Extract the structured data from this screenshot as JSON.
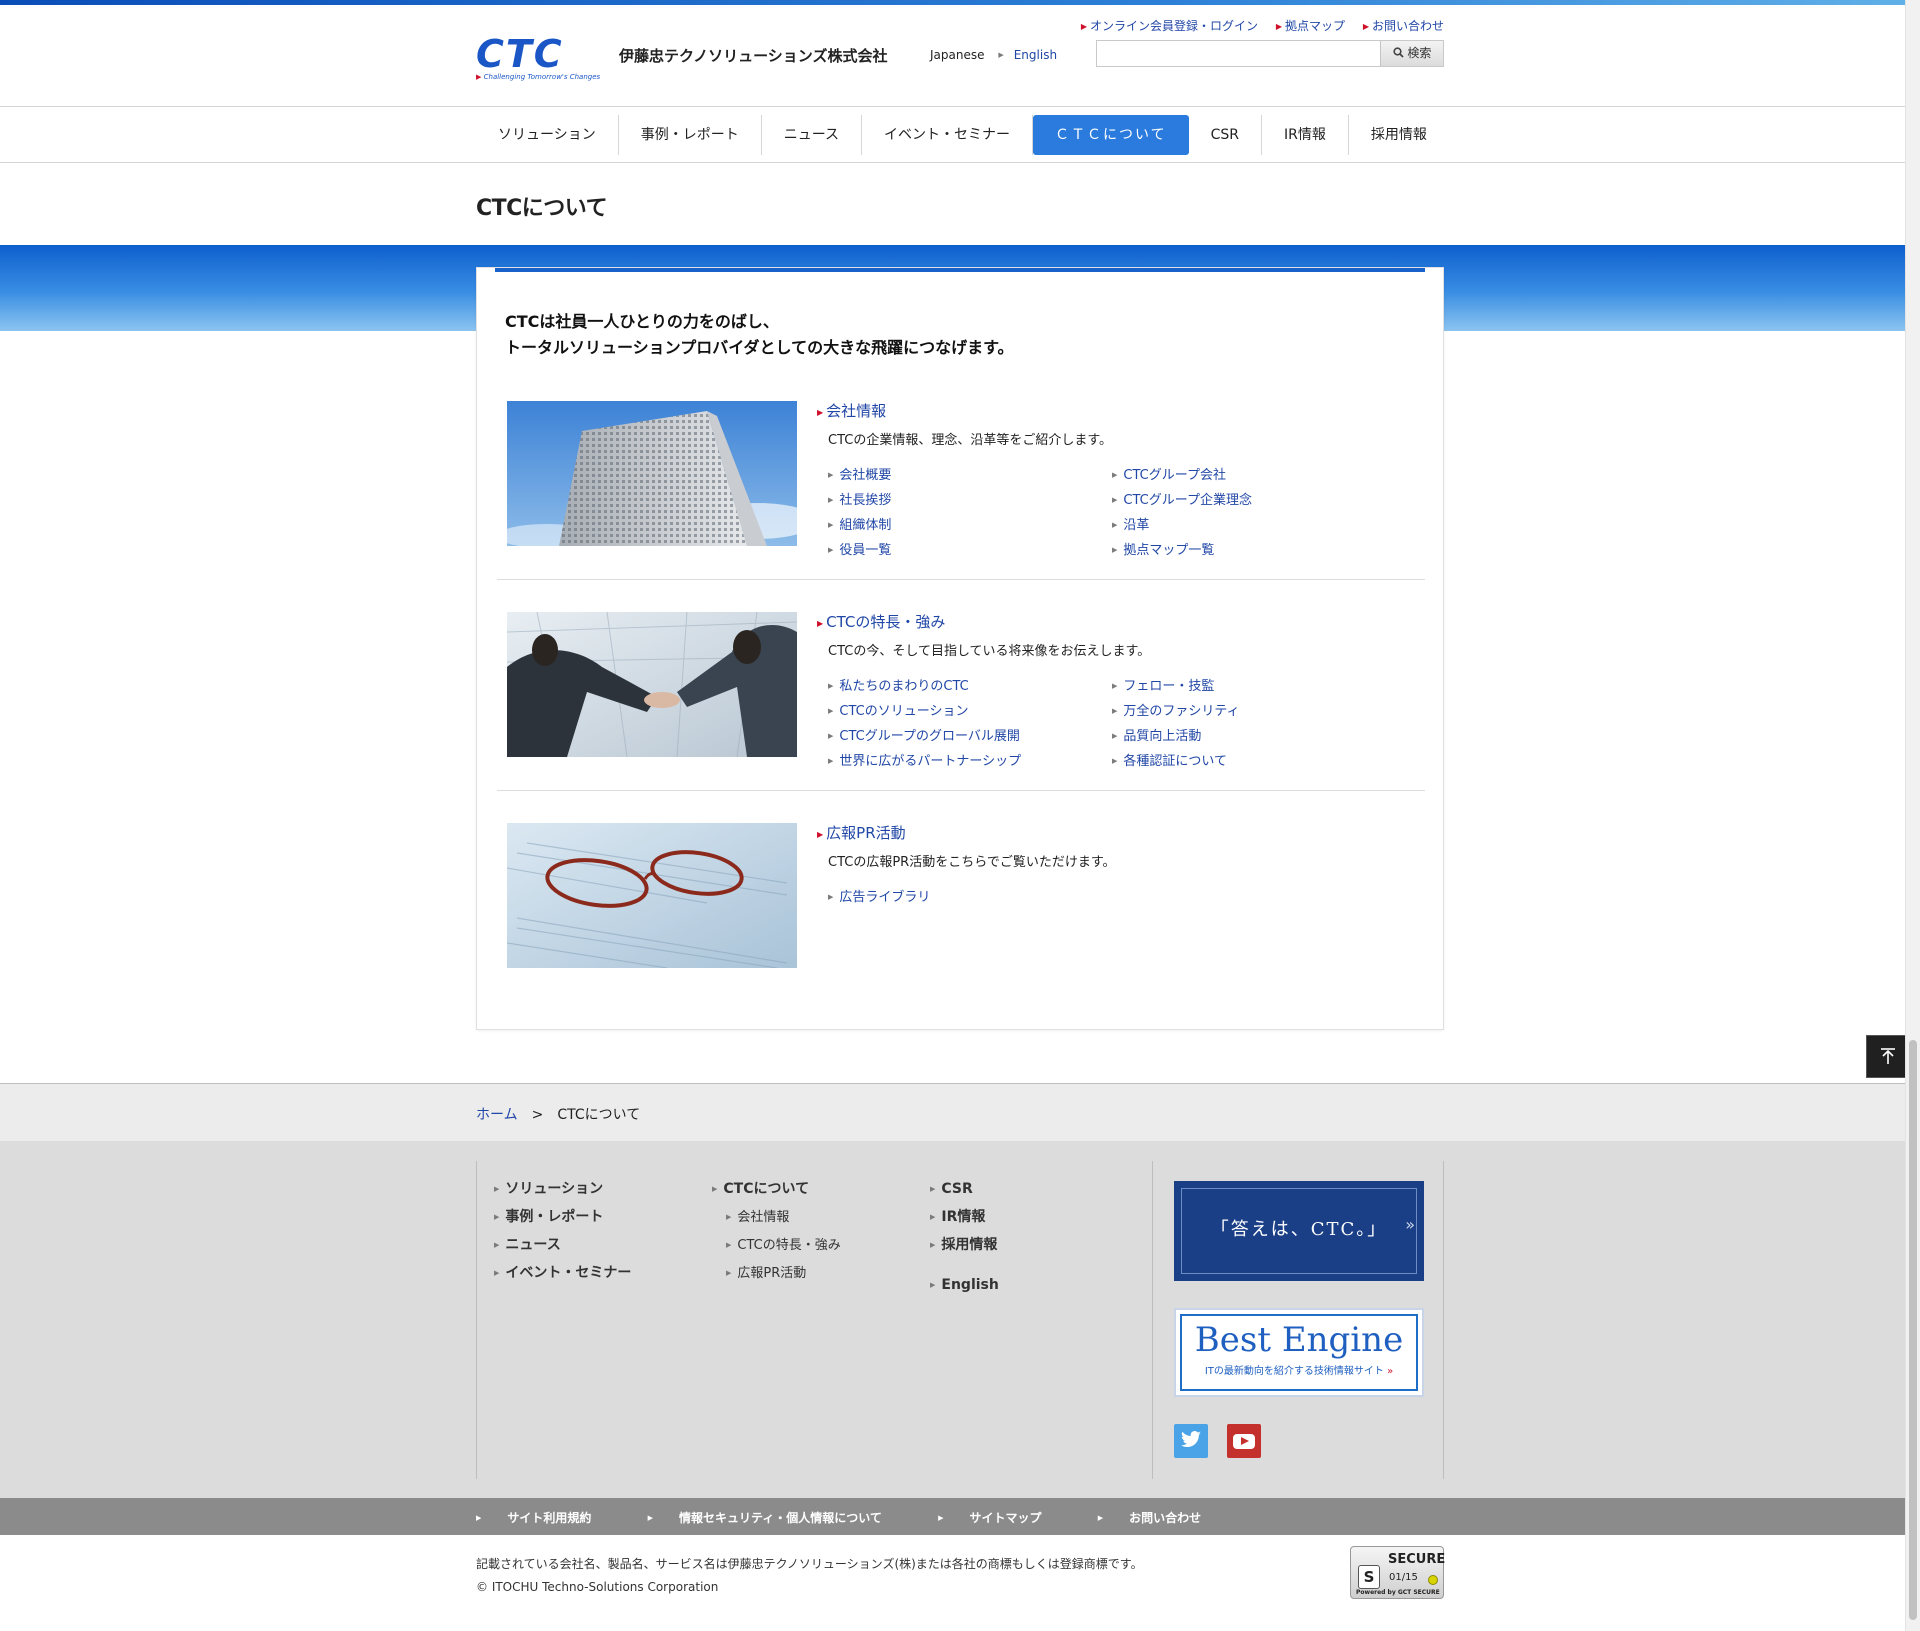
{
  "header": {
    "logo_text": "CTC",
    "logo_tagline": "Challenging Tomorrow's Changes",
    "company_name": "伊藤忠テクノソリューションズ株式会社",
    "lang_japanese": "Japanese",
    "lang_english": "English",
    "util_links": [
      "オンライン会員登録・ログイン",
      "拠点マップ",
      "お問い合わせ"
    ],
    "search_placeholder": "",
    "search_button": "検索"
  },
  "nav": {
    "items": [
      "ソリューション",
      "事例・レポート",
      "ニュース",
      "イベント・セミナー",
      "ＣＴＣについて",
      "CSR",
      "IR情報",
      "採用情報"
    ],
    "active_index": 4
  },
  "page_title": "CTCについて",
  "lead": {
    "line1": "CTCは社員一人ひとりの力をのばし、",
    "line2": "トータルソリューションプロバイダとしての大きな飛躍につなげます。"
  },
  "sections": [
    {
      "title": "会社情報",
      "desc": "CTCの企業情報、理念、沿革等をご紹介します。",
      "links": [
        "会社概要",
        "CTCグループ会社",
        "社長挨拶",
        "CTCグループ企業理念",
        "組織体制",
        "沿革",
        "役員一覧",
        "拠点マップ一覧"
      ]
    },
    {
      "title": "CTCの特長・強み",
      "desc": "CTCの今、そして目指している将来像をお伝えします。",
      "links": [
        "私たちのまわりのCTC",
        "フェロー・技監",
        "CTCのソリューション",
        "万全のファシリティ",
        "CTCグループのグローバル展開",
        "品質向上活動",
        "世界に広がるパートナーシップ",
        "各種認証について"
      ]
    },
    {
      "title": "広報PR活動",
      "desc": "CTCの広報PR活動をこちらでご覧いただけます。",
      "links": [
        "広告ライブラリ"
      ]
    }
  ],
  "breadcrumb": {
    "home": "ホーム",
    "separator": ">",
    "current": "CTCについて"
  },
  "footer": {
    "col1": [
      "ソリューション",
      "事例・レポート",
      "ニュース",
      "イベント・セミナー"
    ],
    "col2_title": "CTCについて",
    "col2_sub": [
      "会社情報",
      "CTCの特長・強み",
      "広報PR活動"
    ],
    "col3": [
      "CSR",
      "IR情報",
      "採用情報"
    ],
    "col3_english": "English",
    "banner1_text": "「答えは、CTC。」",
    "banner2_big": "Best Engine",
    "banner2_small": "ITの最新動向を紹介する技術情報サイト",
    "social": [
      "twitter-icon",
      "youtube-icon"
    ]
  },
  "bottom_links": [
    "サイト利用規約",
    "情報セキュリティ・個人情報について",
    "サイトマップ",
    "お問い合わせ"
  ],
  "copyright": {
    "trademark": "記載されている会社名、製品名、サービス名は伊藤忠テクノソリューションズ(株)または各社の商標もしくは登録商標です。",
    "corp": "© ITOCHU Techno-Solutions Corporation"
  },
  "secure_seal": {
    "label": "SECURE",
    "date": "01/15",
    "by": "Powered by GCT SECURE"
  },
  "colors": {
    "brand_blue": "#1b56c6",
    "link_blue": "#2147a6",
    "nav_active": "#2a7bdd",
    "arrow_red": "#d0112b"
  }
}
